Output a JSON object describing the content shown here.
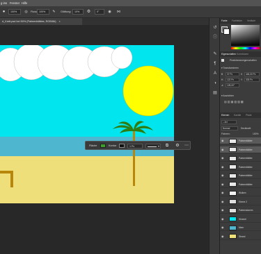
{
  "menubar": {
    "items": [
      "g-ins",
      "Fenster",
      "Hilfe"
    ]
  },
  "options": {
    "mode_value": "100%",
    "flow_label": "Fluss:",
    "flow_value": "100%",
    "smoothing_label": "Glättung:",
    "smoothing_value": "10%",
    "angle_value": "0°"
  },
  "document": {
    "tab_title": "d_Krett.psd bei 50% (Palmenblättes, RGB/8#)",
    "close_glyph": "×"
  },
  "context_bar": {
    "fill_label": "Fläche",
    "stroke_label": "Kontur",
    "stroke_width": "1 Px"
  },
  "panels": {
    "color_tabs": [
      "Farbe",
      "Farbfelder",
      "Verläufe"
    ],
    "properties_tabs": [
      "Eigenschaften",
      "Korrekturen"
    ],
    "pixel_layer_label": "Pixelebeneneigenschaften",
    "transform_header": "Transformieren",
    "transform": {
      "w": "37 Px",
      "x": "446,00 Px",
      "h": "122 Px",
      "y": "333 Px",
      "angle": "128,00°"
    },
    "align_header": "Ausrichten",
    "layers_tabs": [
      "Ebenen",
      "Kanäle",
      "Pfade"
    ],
    "filter_placeholder": "Art",
    "blend_mode": "Normal",
    "lock_label": "Fixieren:",
    "opacity_label": "Deckkraft:",
    "opacity_value": "100%"
  },
  "layers": [
    {
      "name": "Palmenblätter",
      "thumb": "#e8e8e8",
      "selected": true
    },
    {
      "name": "Palmenblätter",
      "thumb": "#e8e8e8",
      "selected": true
    },
    {
      "name": "Palmenblätter",
      "thumb": "#e8e8e8",
      "selected": false
    },
    {
      "name": "Palmenblätter",
      "thumb": "#e8e8e8",
      "selected": false
    },
    {
      "name": "Palmenblätter",
      "thumb": "#e8e8e8",
      "selected": false
    },
    {
      "name": "Palmenblätter",
      "thumb": "#e8e8e8",
      "selected": false
    },
    {
      "name": "Wolken",
      "thumb": "#f2f2f2",
      "selected": false
    },
    {
      "name": "Ebene 2",
      "thumb": "#e0e0e0",
      "selected": false
    },
    {
      "name": "Palmenstamm",
      "thumb": "#e0e0e0",
      "selected": false
    },
    {
      "name": "Himmel",
      "thumb": "#00e5ee",
      "selected": false
    },
    {
      "name": "Meer",
      "thumb": "#4fb6d0",
      "selected": false
    },
    {
      "name": "Strand",
      "thumb": "#f0e07a",
      "selected": false
    }
  ],
  "colors": {
    "sky": "#00e5ee",
    "sea": "#4fb6d0",
    "sand": "#efdf7a",
    "sun": "#ffff00",
    "palm_leaf": "#2f7d12",
    "trunk": "#b8860b",
    "ui_dark": "#282828",
    "fill_swatch": "#3aa02a"
  }
}
